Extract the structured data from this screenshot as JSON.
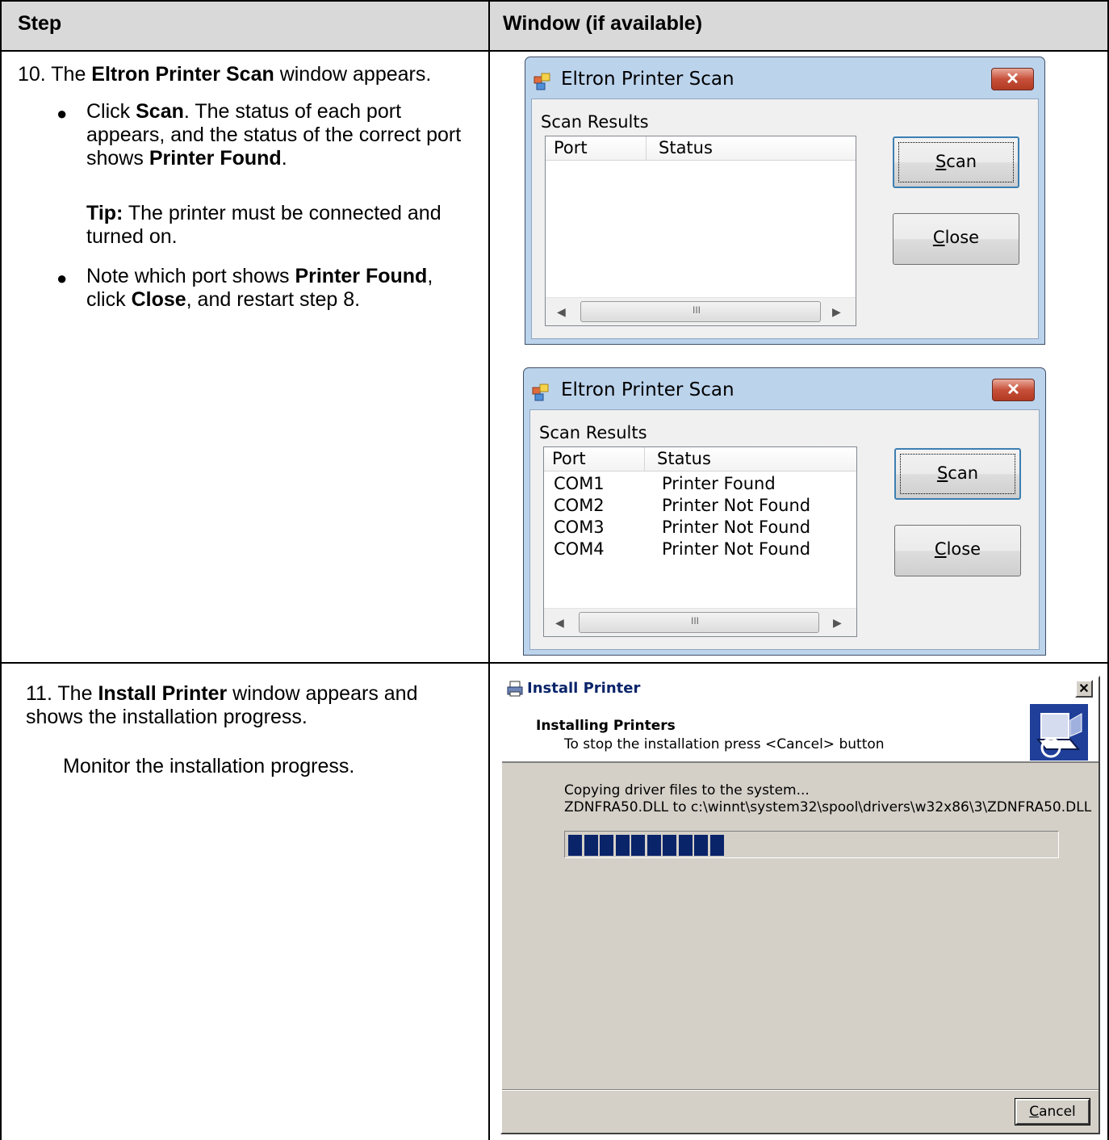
{
  "table": {
    "header": {
      "step": "Step",
      "window": "Window (if available)"
    }
  },
  "rows": [
    {
      "number": "10.",
      "intro": {
        "prefix": "The ",
        "bold": "Eltron Printer Scan",
        "suffix": " window appears."
      },
      "bullet1": {
        "lead": "Click ",
        "bold": "Scan",
        "rest": ". The status of each port appears, and the status of the correct port shows ",
        "bold2": "Printer Found",
        "end": "."
      },
      "tip": {
        "label": "Tip:",
        "text": " The printer must be connected and turned on."
      },
      "bullet2": {
        "lead": "Note which port shows ",
        "bold": "Printer Found",
        "mid": ", click ",
        "bold2": "Close",
        "end": ", and restart step 8."
      }
    },
    {
      "number": "11.",
      "intro": {
        "prefix": "The ",
        "bold": "Install Printer",
        "suffix": " window appears and shows the installation progress."
      },
      "note": "Monitor the installation progress."
    }
  ],
  "scan_dialog": {
    "title": "Eltron Printer Scan",
    "close_glyph": "✕",
    "group_label": "Scan Results",
    "columns": [
      "Port",
      "Status"
    ],
    "scan_button": {
      "mnemonic": "S",
      "rest": "can"
    },
    "close_button": {
      "mnemonic": "C",
      "rest": "lose"
    },
    "scroll_thumb_grip": "III",
    "arrow_left": "◀",
    "arrow_right": "▶"
  },
  "scan_results": [
    {
      "port": "COM1",
      "status": "Printer Found"
    },
    {
      "port": "COM2",
      "status": "Printer Not Found"
    },
    {
      "port": "COM3",
      "status": "Printer Not Found"
    },
    {
      "port": "COM4",
      "status": "Printer Not Found"
    }
  ],
  "install_dialog": {
    "title": "Install Printer",
    "close_glyph": "✕",
    "heading": "Installing Printers",
    "subheading": "To stop the installation press <Cancel> button",
    "status_line1": "Copying driver files to the system...",
    "status_line2": "ZDNFRA50.DLL to c:\\winnt\\system32\\spool\\drivers\\w32x86\\3\\ZDNFRA50.DLL",
    "progress_blocks": 10,
    "cancel_button": {
      "mnemonic": "C",
      "rest": "ancel"
    }
  },
  "colors": {
    "header_bg": "#d9d9d9",
    "progress": "#0a246a",
    "dialog_bg": "#d4d0c8"
  }
}
